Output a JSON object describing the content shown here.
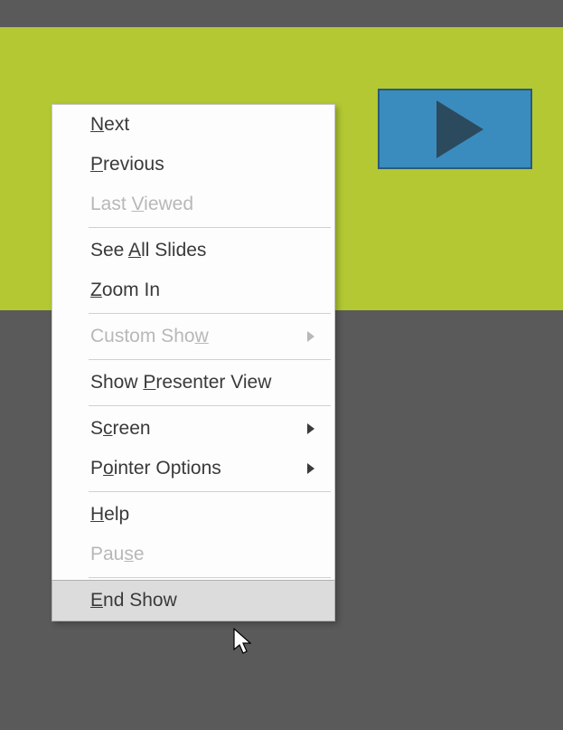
{
  "menu": {
    "next": {
      "pre": "",
      "u": "N",
      "post": "ext"
    },
    "previous": {
      "pre": "",
      "u": "P",
      "post": "revious"
    },
    "last_viewed": {
      "pre": "Last ",
      "u": "V",
      "post": "iewed"
    },
    "see_all_slides": {
      "pre": "See ",
      "u": "A",
      "post": "ll Slides"
    },
    "zoom_in": {
      "pre": "",
      "u": "Z",
      "post": "oom In"
    },
    "custom_show": {
      "pre": "Custom Sho",
      "u": "w",
      "post": ""
    },
    "presenter_view": {
      "pre": "Show ",
      "u": "P",
      "post": "resenter View"
    },
    "screen": {
      "pre": "S",
      "u": "c",
      "post": "reen"
    },
    "pointer_options": {
      "pre": "P",
      "u": "o",
      "post": "inter Options"
    },
    "help": {
      "pre": "",
      "u": "H",
      "post": "elp"
    },
    "pause": {
      "pre": "Pau",
      "u": "s",
      "post": "e"
    },
    "end_show": {
      "pre": "",
      "u": "E",
      "post": "nd Show"
    }
  }
}
